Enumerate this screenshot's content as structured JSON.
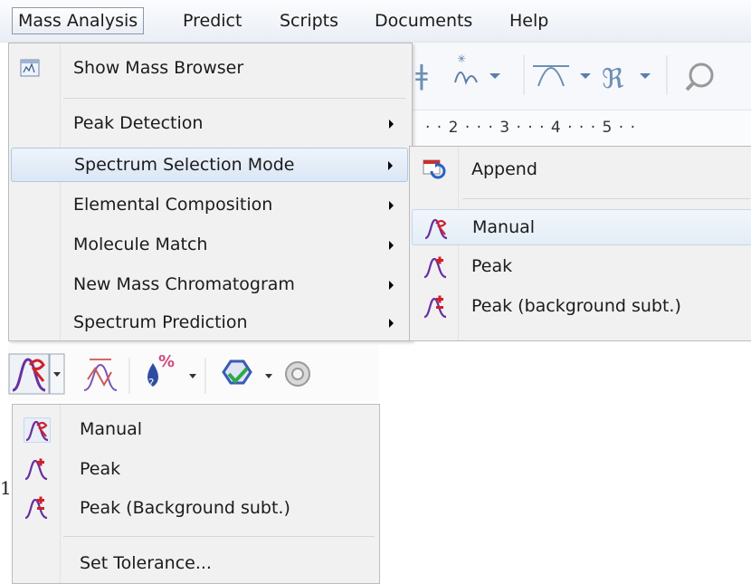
{
  "menubar": {
    "items": [
      {
        "label": "Mass Analysis",
        "open": true
      },
      {
        "label": "Predict"
      },
      {
        "label": "Scripts"
      },
      {
        "label": "Documents"
      },
      {
        "label": "Help"
      }
    ]
  },
  "ruler": {
    "ticks": "· · 2 · · · 3 · · · 4 · · · 5 · ·"
  },
  "mass_menu": {
    "items": [
      {
        "label": "Show Mass Browser",
        "icon": "mass-browser-icon",
        "has_submenu": false
      },
      {
        "label": "Peak Detection",
        "has_submenu": true
      },
      {
        "label": "Spectrum Selection Mode",
        "has_submenu": true,
        "highlighted": true
      },
      {
        "label": "Elemental Composition",
        "has_submenu": true
      },
      {
        "label": "Molecule Match",
        "has_submenu": true
      },
      {
        "label": "New Mass Chromatogram",
        "has_submenu": true
      },
      {
        "label": "Spectrum Prediction",
        "has_submenu": true
      }
    ]
  },
  "selection_submenu": {
    "items": [
      {
        "label": "Append",
        "icon": "append-icon"
      },
      {
        "label": "Manual",
        "icon": "manual-spectrum-icon",
        "highlighted": true
      },
      {
        "label": "Peak",
        "icon": "peak-spectrum-icon"
      },
      {
        "label": "Peak (background subt.)",
        "icon": "peak-background-icon"
      }
    ]
  },
  "toolbar": {
    "icons": [
      "manual-spectrum-icon",
      "dropdown-arrow-icon",
      "spectrum-range-icon",
      "percent-drop-icon",
      "dropdown-arrow-icon",
      "molecule-match-icon",
      "dropdown-arrow-icon",
      "settings-gear-icon"
    ]
  },
  "mode_dropdown": {
    "items": [
      {
        "label": "Manual",
        "icon": "manual-spectrum-icon",
        "selected": true
      },
      {
        "label": "Peak",
        "icon": "peak-spectrum-icon"
      },
      {
        "label": "Peak (Background subt.)",
        "icon": "peak-background-icon"
      },
      {
        "label": "Set Tolerance...",
        "icon": ""
      }
    ]
  },
  "stray_text": "1",
  "colors": {
    "menu_bg": "#f1f1f1",
    "highlight": "#dbe7f5",
    "icon_purple": "#6a2fa0",
    "icon_red": "#d0202a"
  }
}
